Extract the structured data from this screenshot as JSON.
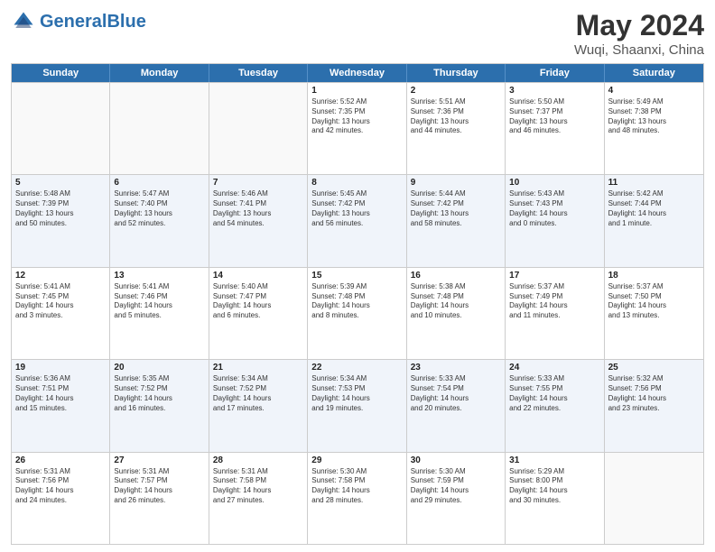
{
  "header": {
    "logo_general": "General",
    "logo_blue": "Blue",
    "title": "May 2024",
    "subtitle": "Wuqi, Shaanxi, China"
  },
  "days_of_week": [
    "Sunday",
    "Monday",
    "Tuesday",
    "Wednesday",
    "Thursday",
    "Friday",
    "Saturday"
  ],
  "rows": [
    {
      "alt": false,
      "cells": [
        {
          "day": "",
          "lines": []
        },
        {
          "day": "",
          "lines": []
        },
        {
          "day": "",
          "lines": []
        },
        {
          "day": "1",
          "lines": [
            "Sunrise: 5:52 AM",
            "Sunset: 7:35 PM",
            "Daylight: 13 hours",
            "and 42 minutes."
          ]
        },
        {
          "day": "2",
          "lines": [
            "Sunrise: 5:51 AM",
            "Sunset: 7:36 PM",
            "Daylight: 13 hours",
            "and 44 minutes."
          ]
        },
        {
          "day": "3",
          "lines": [
            "Sunrise: 5:50 AM",
            "Sunset: 7:37 PM",
            "Daylight: 13 hours",
            "and 46 minutes."
          ]
        },
        {
          "day": "4",
          "lines": [
            "Sunrise: 5:49 AM",
            "Sunset: 7:38 PM",
            "Daylight: 13 hours",
            "and 48 minutes."
          ]
        }
      ]
    },
    {
      "alt": true,
      "cells": [
        {
          "day": "5",
          "lines": [
            "Sunrise: 5:48 AM",
            "Sunset: 7:39 PM",
            "Daylight: 13 hours",
            "and 50 minutes."
          ]
        },
        {
          "day": "6",
          "lines": [
            "Sunrise: 5:47 AM",
            "Sunset: 7:40 PM",
            "Daylight: 13 hours",
            "and 52 minutes."
          ]
        },
        {
          "day": "7",
          "lines": [
            "Sunrise: 5:46 AM",
            "Sunset: 7:41 PM",
            "Daylight: 13 hours",
            "and 54 minutes."
          ]
        },
        {
          "day": "8",
          "lines": [
            "Sunrise: 5:45 AM",
            "Sunset: 7:42 PM",
            "Daylight: 13 hours",
            "and 56 minutes."
          ]
        },
        {
          "day": "9",
          "lines": [
            "Sunrise: 5:44 AM",
            "Sunset: 7:42 PM",
            "Daylight: 13 hours",
            "and 58 minutes."
          ]
        },
        {
          "day": "10",
          "lines": [
            "Sunrise: 5:43 AM",
            "Sunset: 7:43 PM",
            "Daylight: 14 hours",
            "and 0 minutes."
          ]
        },
        {
          "day": "11",
          "lines": [
            "Sunrise: 5:42 AM",
            "Sunset: 7:44 PM",
            "Daylight: 14 hours",
            "and 1 minute."
          ]
        }
      ]
    },
    {
      "alt": false,
      "cells": [
        {
          "day": "12",
          "lines": [
            "Sunrise: 5:41 AM",
            "Sunset: 7:45 PM",
            "Daylight: 14 hours",
            "and 3 minutes."
          ]
        },
        {
          "day": "13",
          "lines": [
            "Sunrise: 5:41 AM",
            "Sunset: 7:46 PM",
            "Daylight: 14 hours",
            "and 5 minutes."
          ]
        },
        {
          "day": "14",
          "lines": [
            "Sunrise: 5:40 AM",
            "Sunset: 7:47 PM",
            "Daylight: 14 hours",
            "and 6 minutes."
          ]
        },
        {
          "day": "15",
          "lines": [
            "Sunrise: 5:39 AM",
            "Sunset: 7:48 PM",
            "Daylight: 14 hours",
            "and 8 minutes."
          ]
        },
        {
          "day": "16",
          "lines": [
            "Sunrise: 5:38 AM",
            "Sunset: 7:48 PM",
            "Daylight: 14 hours",
            "and 10 minutes."
          ]
        },
        {
          "day": "17",
          "lines": [
            "Sunrise: 5:37 AM",
            "Sunset: 7:49 PM",
            "Daylight: 14 hours",
            "and 11 minutes."
          ]
        },
        {
          "day": "18",
          "lines": [
            "Sunrise: 5:37 AM",
            "Sunset: 7:50 PM",
            "Daylight: 14 hours",
            "and 13 minutes."
          ]
        }
      ]
    },
    {
      "alt": true,
      "cells": [
        {
          "day": "19",
          "lines": [
            "Sunrise: 5:36 AM",
            "Sunset: 7:51 PM",
            "Daylight: 14 hours",
            "and 15 minutes."
          ]
        },
        {
          "day": "20",
          "lines": [
            "Sunrise: 5:35 AM",
            "Sunset: 7:52 PM",
            "Daylight: 14 hours",
            "and 16 minutes."
          ]
        },
        {
          "day": "21",
          "lines": [
            "Sunrise: 5:34 AM",
            "Sunset: 7:52 PM",
            "Daylight: 14 hours",
            "and 17 minutes."
          ]
        },
        {
          "day": "22",
          "lines": [
            "Sunrise: 5:34 AM",
            "Sunset: 7:53 PM",
            "Daylight: 14 hours",
            "and 19 minutes."
          ]
        },
        {
          "day": "23",
          "lines": [
            "Sunrise: 5:33 AM",
            "Sunset: 7:54 PM",
            "Daylight: 14 hours",
            "and 20 minutes."
          ]
        },
        {
          "day": "24",
          "lines": [
            "Sunrise: 5:33 AM",
            "Sunset: 7:55 PM",
            "Daylight: 14 hours",
            "and 22 minutes."
          ]
        },
        {
          "day": "25",
          "lines": [
            "Sunrise: 5:32 AM",
            "Sunset: 7:56 PM",
            "Daylight: 14 hours",
            "and 23 minutes."
          ]
        }
      ]
    },
    {
      "alt": false,
      "cells": [
        {
          "day": "26",
          "lines": [
            "Sunrise: 5:31 AM",
            "Sunset: 7:56 PM",
            "Daylight: 14 hours",
            "and 24 minutes."
          ]
        },
        {
          "day": "27",
          "lines": [
            "Sunrise: 5:31 AM",
            "Sunset: 7:57 PM",
            "Daylight: 14 hours",
            "and 26 minutes."
          ]
        },
        {
          "day": "28",
          "lines": [
            "Sunrise: 5:31 AM",
            "Sunset: 7:58 PM",
            "Daylight: 14 hours",
            "and 27 minutes."
          ]
        },
        {
          "day": "29",
          "lines": [
            "Sunrise: 5:30 AM",
            "Sunset: 7:58 PM",
            "Daylight: 14 hours",
            "and 28 minutes."
          ]
        },
        {
          "day": "30",
          "lines": [
            "Sunrise: 5:30 AM",
            "Sunset: 7:59 PM",
            "Daylight: 14 hours",
            "and 29 minutes."
          ]
        },
        {
          "day": "31",
          "lines": [
            "Sunrise: 5:29 AM",
            "Sunset: 8:00 PM",
            "Daylight: 14 hours",
            "and 30 minutes."
          ]
        },
        {
          "day": "",
          "lines": []
        }
      ]
    }
  ]
}
